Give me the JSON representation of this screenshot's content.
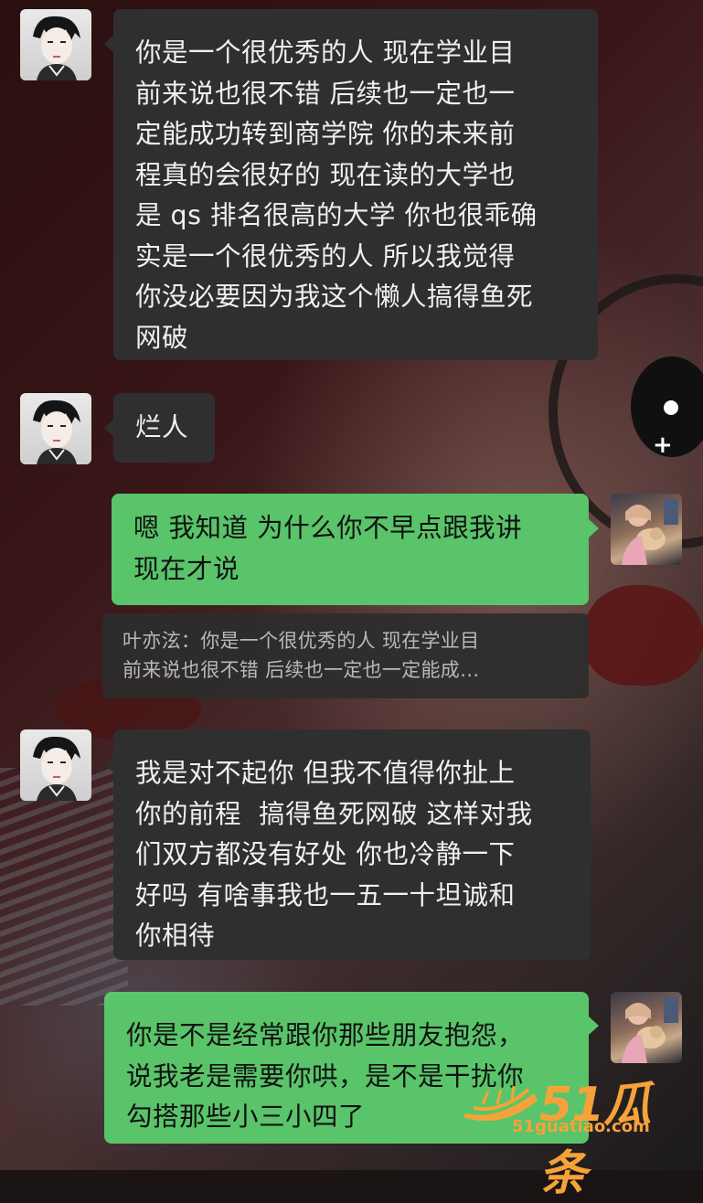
{
  "messages": [
    {
      "side": "in",
      "avatar": "anime-boy-avatar",
      "text": "你是一个很优秀的人 现在学业目\n前来说也很不错 后续也一定也一\n定能成功转到商学院 你的未来前\n程真的会很好的 现在读的大学也\n是 qs 排名很高的大学 你也很乖确\n实是一个很优秀的人 所以我觉得\n你没必要因为我这个懒人搞得鱼死\n网破"
    },
    {
      "side": "in",
      "avatar": "anime-boy-avatar",
      "text": "烂人"
    },
    {
      "side": "out",
      "avatar": "girl-with-dog-avatar",
      "text": "嗯 我知道 为什么你不早点跟我讲\n现在才说"
    },
    {
      "side": "in",
      "avatar": "anime-boy-avatar",
      "text": "我是对不起你 但我不值得你扯上\n你的前程  搞得鱼死网破 这样对我\n们双方都没有好处 你也冷静一下\n好吗 有啥事我也一五一十坦诚和\n你相待"
    },
    {
      "side": "out",
      "avatar": "girl-with-dog-avatar",
      "text": "你是不是经常跟你那些朋友抱怨，\n说我老是需要你哄，是不是干扰你\n勾搭那些小三小四了"
    }
  ],
  "quote": {
    "line1": "叶亦泫：你是一个很优秀的人 现在学业目",
    "line2": "前来说也很不错 后续也一定也一定能成…"
  },
  "watermark": {
    "brand": "51瓜条",
    "url": "51guatiao.com"
  },
  "colors": {
    "incoming_bubble": "#2f2f2f",
    "outgoing_bubble": "#59c46a",
    "watermark": "#f6a23a"
  }
}
